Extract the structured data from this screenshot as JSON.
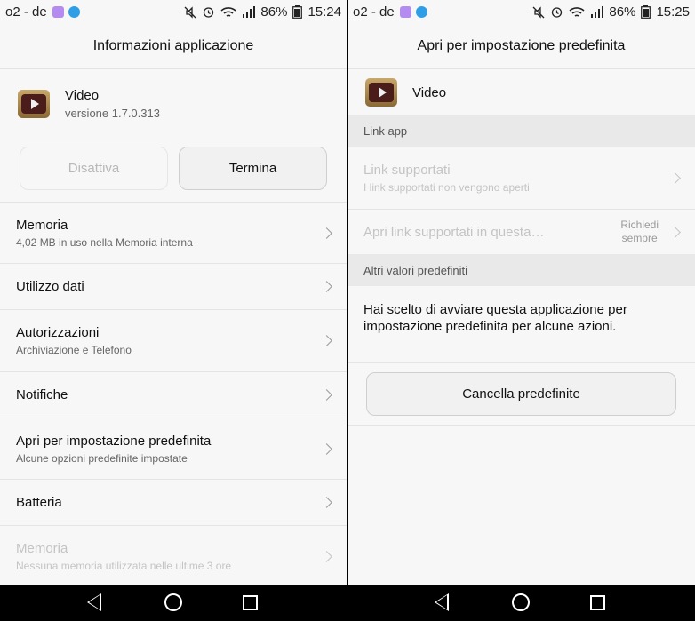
{
  "left": {
    "status": {
      "carrier": "o2 - de",
      "battery": "86%",
      "time": "15:24"
    },
    "title": "Informazioni applicazione",
    "app": {
      "name": "Video",
      "version": "versione 1.7.0.313"
    },
    "buttons": {
      "disable": "Disattiva",
      "stop": "Termina"
    },
    "rows": [
      {
        "title": "Memoria",
        "sub": "4,02 MB in uso nella Memoria interna"
      },
      {
        "title": "Utilizzo dati"
      },
      {
        "title": "Autorizzazioni",
        "sub": "Archiviazione e Telefono"
      },
      {
        "title": "Notifiche"
      },
      {
        "title": "Apri per impostazione predefinita",
        "sub": "Alcune opzioni predefinite impostate"
      },
      {
        "title": "Batteria"
      },
      {
        "title": "Memoria",
        "sub": "Nessuna memoria utilizzata nelle ultime 3 ore"
      }
    ]
  },
  "right": {
    "status": {
      "carrier": "o2 - de",
      "battery": "86%",
      "time": "15:25"
    },
    "title": "Apri per impostazione predefinita",
    "app": {
      "name": "Video"
    },
    "section_link": "Link app",
    "supported_links": {
      "title": "Link supportati",
      "sub": "I link supportati non vengono aperti"
    },
    "open_links": {
      "title": "Apri link supportati in questa…",
      "value_line1": "Richiedi",
      "value_line2": "sempre"
    },
    "section_defaults": "Altri valori predefiniti",
    "defaults_text": "Hai scelto di avviare questa applicazione per impostazione predefinita per alcune azioni.",
    "clear_button": "Cancella predefinite"
  },
  "colors": {
    "background": "#f7f7f7",
    "section": "#e9e9e9",
    "disabled_text": "#c4c4c4",
    "navbar": "#000000"
  },
  "icons": [
    "mute-icon",
    "alarm-icon",
    "wifi-icon",
    "signal-icon",
    "battery-icon",
    "back-icon",
    "home-icon",
    "recents-icon",
    "chevron-right-icon",
    "video-app-icon"
  ]
}
